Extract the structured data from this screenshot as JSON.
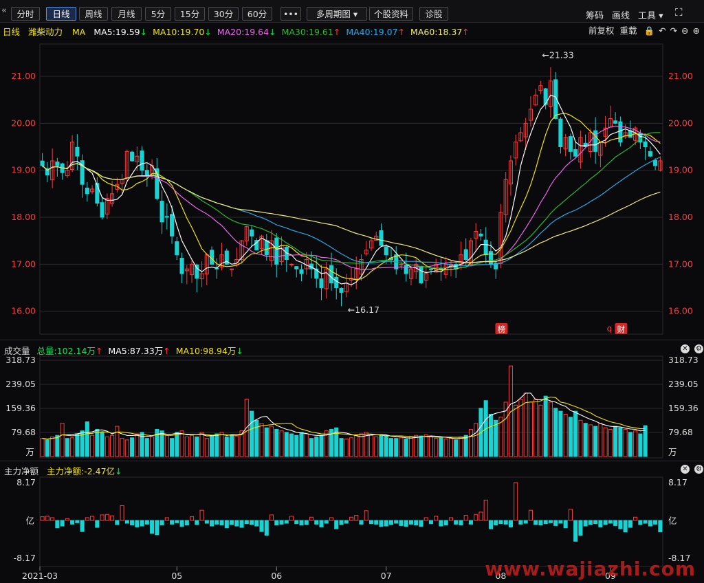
{
  "toolbar": {
    "back_arrow": "«",
    "buttons": [
      "分时",
      "日线",
      "周线",
      "月线",
      "5分",
      "15分",
      "30分",
      "60分",
      "•••",
      "多周期图 ▾",
      "个股资料",
      "诊股"
    ],
    "active_index": 1,
    "right": [
      "筹码",
      "画线",
      "工具 ▾",
      "⛶"
    ]
  },
  "main_legend": {
    "period": "日线",
    "stock": "潍柴动力",
    "indicator": "MA",
    "items": [
      {
        "text": "MA5:19.59",
        "arrow": "↓",
        "color": "#ffffff",
        "arrow_color": "#19e05a"
      },
      {
        "text": "MA10:19.70",
        "arrow": "↓",
        "color": "#f2e600",
        "arrow_color": "#19e05a"
      },
      {
        "text": "MA20:19.64",
        "arrow": "↓",
        "color": "#ee66ee",
        "arrow_color": "#19e05a"
      },
      {
        "text": "MA30:19.61",
        "arrow": "↑",
        "color": "#2cb82c",
        "arrow_color": "#ff3b3b"
      },
      {
        "text": "MA40:19.07",
        "arrow": "↑",
        "color": "#2aa8e6",
        "arrow_color": "#ff3b3b"
      },
      {
        "text": "MA60:18.37",
        "arrow": "↑",
        "color": "#f0ec7a",
        "arrow_color": "#ff3b3b"
      }
    ],
    "right_labels": [
      "前复权",
      "重载"
    ]
  },
  "volume_legend": {
    "title": "成交量",
    "total": "总量:102.14万",
    "total_arrow": "↑",
    "ma5": "MA5:87.33万",
    "ma5_arrow": "↑",
    "ma10": "MA10:98.94万",
    "ma10_arrow": "↓"
  },
  "flow_legend": {
    "title": "主力净额",
    "value": "主力净额:-2.47亿",
    "arrow": "↓"
  },
  "badges": {
    "bang": "榜",
    "cai": "财",
    "q": "q"
  },
  "watermark": "www.wajiazhi.com",
  "colors": {
    "up": "#ff3b3b",
    "down": "#19d3d3",
    "grid": "#2a2a2e"
  },
  "chart_data": [
    {
      "type": "candlestick",
      "title": "潍柴动力 日线",
      "y_ticks": [
        "21.00",
        "20.00",
        "19.00",
        "18.00",
        "17.00",
        "16.00"
      ],
      "ylim": [
        15.6,
        21.6
      ],
      "x_tick_labels": [
        {
          "label": "2021-03",
          "index": 0
        },
        {
          "label": "05",
          "index": 27
        },
        {
          "label": "06",
          "index": 47
        },
        {
          "label": "07",
          "index": 69
        },
        {
          "label": "08",
          "index": 92
        },
        {
          "label": "09",
          "index": 114
        }
      ],
      "annotations": [
        {
          "text": "←21.33",
          "index": 100,
          "value": 21.33,
          "position": "high"
        },
        {
          "text": "←16.17",
          "index": 61,
          "value": 16.17,
          "position": "low"
        }
      ],
      "close": [
        19.1,
        18.9,
        19.2,
        19.1,
        18.95,
        19.0,
        19.6,
        19.3,
        18.7,
        18.5,
        18.6,
        18.3,
        18.0,
        18.4,
        18.5,
        18.7,
        18.8,
        19.4,
        19.2,
        19.3,
        19.0,
        18.9,
        19.1,
        18.4,
        17.9,
        18.0,
        17.6,
        17.2,
        16.8,
        16.9,
        17.0,
        16.7,
        16.8,
        17.2,
        17.0,
        16.9,
        17.2,
        17.0,
        16.9,
        17.1,
        17.5,
        17.8,
        17.6,
        17.3,
        17.6,
        17.2,
        17.5,
        17.0,
        17.4,
        17.1,
        17.0,
        16.9,
        16.8,
        17.1,
        16.9,
        16.7,
        16.5,
        16.9,
        16.6,
        16.5,
        16.4,
        16.6,
        16.7,
        16.9,
        17.1,
        17.3,
        17.5,
        17.6,
        17.4,
        17.2,
        17.1,
        16.9,
        17.0,
        16.8,
        16.9,
        17.0,
        16.6,
        16.8,
        16.9,
        17.0,
        16.9,
        17.0,
        17.0,
        16.9,
        17.2,
        17.1,
        17.5,
        17.7,
        17.6,
        17.2,
        17.0,
        16.9,
        18.1,
        18.8,
        19.2,
        19.6,
        19.8,
        20.0,
        20.3,
        20.6,
        20.8,
        20.4,
        20.9,
        20.1,
        19.5,
        19.7,
        19.4,
        19.3,
        19.7,
        19.5,
        19.8,
        19.4,
        19.6,
        19.9,
        20.1,
        20.0,
        19.6,
        19.8,
        19.7,
        19.9,
        19.6,
        19.5,
        19.3,
        19.1,
        19.2
      ],
      "ma_series": [
        {
          "name": "MA5",
          "color": "#ffffff"
        },
        {
          "name": "MA10",
          "color": "#f2e600"
        },
        {
          "name": "MA20",
          "color": "#ee66ee"
        },
        {
          "name": "MA30",
          "color": "#2cb82c"
        },
        {
          "name": "MA40",
          "color": "#2aa8e6"
        },
        {
          "name": "MA60",
          "color": "#f0ec7a"
        }
      ]
    },
    {
      "type": "bar",
      "title": "成交量",
      "unit": "万",
      "y_ticks": [
        "318.73",
        "239.05",
        "159.36",
        "79.68"
      ],
      "ylim": [
        0,
        318.73
      ],
      "values": [
        60,
        55,
        65,
        70,
        110,
        60,
        62,
        75,
        85,
        115,
        70,
        90,
        80,
        65,
        70,
        100,
        60,
        55,
        62,
        75,
        80,
        60,
        65,
        90,
        85,
        70,
        60,
        80,
        85,
        65,
        70,
        65,
        80,
        60,
        70,
        75,
        80,
        65,
        72,
        68,
        85,
        190,
        150,
        120,
        110,
        95,
        100,
        90,
        85,
        80,
        75,
        70,
        80,
        75,
        60,
        65,
        70,
        85,
        90,
        95,
        60,
        58,
        62,
        70,
        75,
        80,
        70,
        65,
        72,
        70,
        60,
        60,
        62,
        58,
        65,
        70,
        68,
        72,
        66,
        60,
        62,
        58,
        60,
        55,
        65,
        70,
        90,
        110,
        160,
        185,
        140,
        120,
        130,
        180,
        300,
        170,
        190,
        210,
        180,
        190,
        170,
        200,
        180,
        160,
        150,
        140,
        130,
        150,
        120,
        110,
        105,
        100,
        110,
        95,
        90,
        100,
        95,
        90,
        80,
        85,
        75,
        102.14
      ],
      "up": [
        1,
        0,
        1,
        0,
        1,
        0,
        1,
        0,
        0,
        0,
        1,
        0,
        0,
        1,
        1,
        1,
        1,
        1,
        0,
        1,
        0,
        0,
        1,
        0,
        0,
        1,
        0,
        0,
        1,
        1,
        1,
        0,
        1,
        1,
        0,
        0,
        1,
        0,
        0,
        1,
        1,
        1,
        0,
        0,
        1,
        0,
        1,
        0,
        1,
        0,
        0,
        0,
        0,
        1,
        0,
        0,
        0,
        1,
        0,
        0,
        0,
        1,
        1,
        1,
        1,
        1,
        1,
        1,
        0,
        0,
        0,
        0,
        1,
        0,
        1,
        1,
        0,
        1,
        1,
        1,
        0,
        1,
        1,
        0,
        1,
        0,
        1,
        1,
        0,
        0,
        0,
        0,
        1,
        1,
        1,
        1,
        1,
        1,
        1,
        1,
        1,
        0,
        1,
        0,
        0,
        1,
        0,
        0,
        1,
        0,
        1,
        0,
        1,
        1,
        1,
        0,
        0,
        1,
        0,
        1,
        0,
        0,
        0,
        0,
        0
      ]
    },
    {
      "type": "bar",
      "title": "主力净额",
      "unit": "亿",
      "y_ticks": [
        "8.17",
        "-8.17"
      ],
      "ylim": [
        -8.17,
        8.17
      ],
      "values": [
        0.8,
        0.9,
        0.6,
        -1.6,
        -1.2,
        0.4,
        -0.8,
        -0.5,
        -2.4,
        0.6,
        0.9,
        -1.5,
        1.2,
        1.3,
        1.0,
        -0.9,
        3.2,
        -0.6,
        -1.0,
        -1.4,
        -1.2,
        -0.8,
        -2.8,
        -3.1,
        -1.0,
        0.6,
        -0.8,
        -0.5,
        -1.3,
        -1.0,
        0.8,
        -0.9,
        2.2,
        -0.6,
        -1.2,
        -0.8,
        -1.0,
        -1.6,
        -0.9,
        -1.2,
        -1.5,
        -0.7,
        -0.9,
        -1.2,
        -2.4,
        -3.2,
        1.2,
        -1.0,
        -0.8,
        -0.6,
        0.9,
        -0.7,
        -1.0,
        -0.9,
        0.7,
        -0.8,
        -1.4,
        -0.6,
        0.6,
        -1.8,
        -0.9,
        -0.6,
        0.7,
        1.1,
        -0.8,
        2.1,
        -0.7,
        -0.8,
        -1.3,
        -1.2,
        -0.9,
        -0.6,
        -1.1,
        -1.3,
        -0.8,
        -1.0,
        -1.3,
        0.6,
        -0.7,
        0.9,
        -1.2,
        -1.0,
        0.6,
        -0.8,
        -1.0,
        1.1,
        -0.8,
        1.3,
        1.8,
        4.4,
        -1.8,
        -1.0,
        -0.7,
        -0.8,
        -1.4,
        8.17,
        -0.8,
        -0.6,
        2.2,
        -0.9,
        -1.0,
        -0.7,
        -0.5,
        -1.1,
        -0.6,
        -1.6,
        2.4,
        -4.5,
        -3.2,
        -1.2,
        -0.9,
        -0.7,
        -1.4,
        -0.9,
        -0.6,
        -1.1,
        -1.8,
        -2.5,
        -1.5,
        0.7,
        -0.9,
        -0.6,
        -1.2,
        -0.8,
        -2.47
      ]
    }
  ]
}
